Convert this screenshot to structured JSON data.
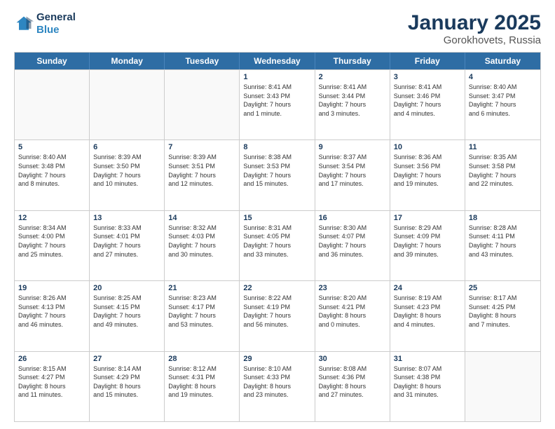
{
  "logo": {
    "line1": "General",
    "line2": "Blue"
  },
  "title": "January 2025",
  "subtitle": "Gorokhovets, Russia",
  "headers": [
    "Sunday",
    "Monday",
    "Tuesday",
    "Wednesday",
    "Thursday",
    "Friday",
    "Saturday"
  ],
  "weeks": [
    [
      {
        "day": "",
        "info": "",
        "empty": true
      },
      {
        "day": "",
        "info": "",
        "empty": true
      },
      {
        "day": "",
        "info": "",
        "empty": true
      },
      {
        "day": "1",
        "info": "Sunrise: 8:41 AM\nSunset: 3:43 PM\nDaylight: 7 hours\nand 1 minute."
      },
      {
        "day": "2",
        "info": "Sunrise: 8:41 AM\nSunset: 3:44 PM\nDaylight: 7 hours\nand 3 minutes."
      },
      {
        "day": "3",
        "info": "Sunrise: 8:41 AM\nSunset: 3:46 PM\nDaylight: 7 hours\nand 4 minutes."
      },
      {
        "day": "4",
        "info": "Sunrise: 8:40 AM\nSunset: 3:47 PM\nDaylight: 7 hours\nand 6 minutes."
      }
    ],
    [
      {
        "day": "5",
        "info": "Sunrise: 8:40 AM\nSunset: 3:48 PM\nDaylight: 7 hours\nand 8 minutes."
      },
      {
        "day": "6",
        "info": "Sunrise: 8:39 AM\nSunset: 3:50 PM\nDaylight: 7 hours\nand 10 minutes."
      },
      {
        "day": "7",
        "info": "Sunrise: 8:39 AM\nSunset: 3:51 PM\nDaylight: 7 hours\nand 12 minutes."
      },
      {
        "day": "8",
        "info": "Sunrise: 8:38 AM\nSunset: 3:53 PM\nDaylight: 7 hours\nand 15 minutes."
      },
      {
        "day": "9",
        "info": "Sunrise: 8:37 AM\nSunset: 3:54 PM\nDaylight: 7 hours\nand 17 minutes."
      },
      {
        "day": "10",
        "info": "Sunrise: 8:36 AM\nSunset: 3:56 PM\nDaylight: 7 hours\nand 19 minutes."
      },
      {
        "day": "11",
        "info": "Sunrise: 8:35 AM\nSunset: 3:58 PM\nDaylight: 7 hours\nand 22 minutes."
      }
    ],
    [
      {
        "day": "12",
        "info": "Sunrise: 8:34 AM\nSunset: 4:00 PM\nDaylight: 7 hours\nand 25 minutes."
      },
      {
        "day": "13",
        "info": "Sunrise: 8:33 AM\nSunset: 4:01 PM\nDaylight: 7 hours\nand 27 minutes."
      },
      {
        "day": "14",
        "info": "Sunrise: 8:32 AM\nSunset: 4:03 PM\nDaylight: 7 hours\nand 30 minutes."
      },
      {
        "day": "15",
        "info": "Sunrise: 8:31 AM\nSunset: 4:05 PM\nDaylight: 7 hours\nand 33 minutes."
      },
      {
        "day": "16",
        "info": "Sunrise: 8:30 AM\nSunset: 4:07 PM\nDaylight: 7 hours\nand 36 minutes."
      },
      {
        "day": "17",
        "info": "Sunrise: 8:29 AM\nSunset: 4:09 PM\nDaylight: 7 hours\nand 39 minutes."
      },
      {
        "day": "18",
        "info": "Sunrise: 8:28 AM\nSunset: 4:11 PM\nDaylight: 7 hours\nand 43 minutes."
      }
    ],
    [
      {
        "day": "19",
        "info": "Sunrise: 8:26 AM\nSunset: 4:13 PM\nDaylight: 7 hours\nand 46 minutes."
      },
      {
        "day": "20",
        "info": "Sunrise: 8:25 AM\nSunset: 4:15 PM\nDaylight: 7 hours\nand 49 minutes."
      },
      {
        "day": "21",
        "info": "Sunrise: 8:23 AM\nSunset: 4:17 PM\nDaylight: 7 hours\nand 53 minutes."
      },
      {
        "day": "22",
        "info": "Sunrise: 8:22 AM\nSunset: 4:19 PM\nDaylight: 7 hours\nand 56 minutes."
      },
      {
        "day": "23",
        "info": "Sunrise: 8:20 AM\nSunset: 4:21 PM\nDaylight: 8 hours\nand 0 minutes."
      },
      {
        "day": "24",
        "info": "Sunrise: 8:19 AM\nSunset: 4:23 PM\nDaylight: 8 hours\nand 4 minutes."
      },
      {
        "day": "25",
        "info": "Sunrise: 8:17 AM\nSunset: 4:25 PM\nDaylight: 8 hours\nand 7 minutes."
      }
    ],
    [
      {
        "day": "26",
        "info": "Sunrise: 8:15 AM\nSunset: 4:27 PM\nDaylight: 8 hours\nand 11 minutes."
      },
      {
        "day": "27",
        "info": "Sunrise: 8:14 AM\nSunset: 4:29 PM\nDaylight: 8 hours\nand 15 minutes."
      },
      {
        "day": "28",
        "info": "Sunrise: 8:12 AM\nSunset: 4:31 PM\nDaylight: 8 hours\nand 19 minutes."
      },
      {
        "day": "29",
        "info": "Sunrise: 8:10 AM\nSunset: 4:33 PM\nDaylight: 8 hours\nand 23 minutes."
      },
      {
        "day": "30",
        "info": "Sunrise: 8:08 AM\nSunset: 4:36 PM\nDaylight: 8 hours\nand 27 minutes."
      },
      {
        "day": "31",
        "info": "Sunrise: 8:07 AM\nSunset: 4:38 PM\nDaylight: 8 hours\nand 31 minutes."
      },
      {
        "day": "",
        "info": "",
        "empty": true
      }
    ]
  ]
}
